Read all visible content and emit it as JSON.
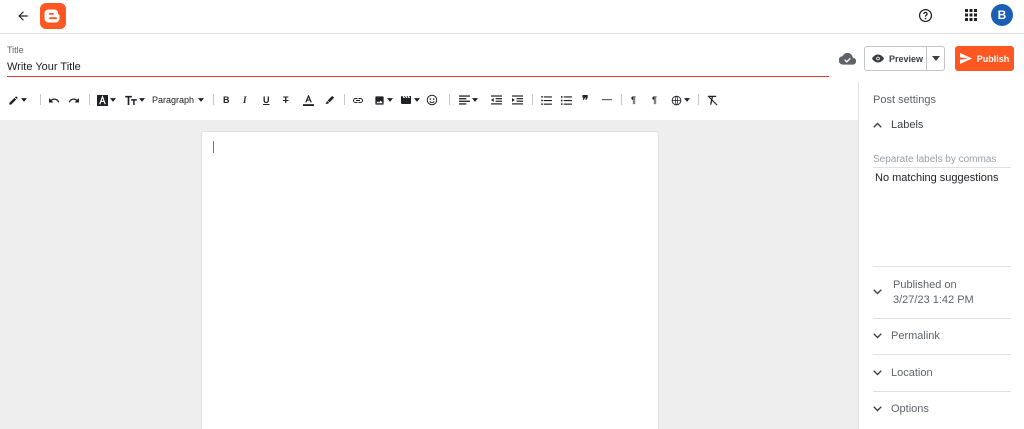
{
  "topbar": {
    "back_icon": "arrow-back-icon",
    "logo": "blogger-logo",
    "help_icon": "help-circle-icon",
    "apps_icon": "apps-grid-icon",
    "avatar_initial": "B",
    "avatar_color": "#1a5fb4"
  },
  "title": {
    "label": "Title",
    "value": "Write Your Title"
  },
  "actions": {
    "preview_label": "Preview",
    "publish_label": "Publish",
    "accent_color": "#ff5722"
  },
  "toolbar": {
    "paragraph_label": "Paragraph",
    "icons": [
      "pencil-icon",
      "undo-icon",
      "redo-icon",
      "font-icon",
      "text-size-icon",
      "bold-icon",
      "italic-icon",
      "underline-icon",
      "strikethrough-icon",
      "text-color-icon",
      "highlight-icon",
      "link-icon",
      "image-icon",
      "video-icon",
      "emoji-icon",
      "align-icon",
      "indent-decrease-icon",
      "indent-increase-icon",
      "bulleted-list-icon",
      "numbered-list-icon",
      "quote-icon",
      "horizontal-rule-icon",
      "ltr-icon",
      "rtl-icon",
      "language-icon",
      "clear-formatting-icon"
    ]
  },
  "settings": {
    "title": "Post settings",
    "labels_header": "Labels",
    "labels_placeholder": "Separate labels by commas",
    "no_suggestions": "No matching suggestions",
    "published_on_label": "Published on",
    "published_on_date": "3/27/23 1:42 PM",
    "permalink": "Permalink",
    "location": "Location",
    "options": "Options"
  }
}
